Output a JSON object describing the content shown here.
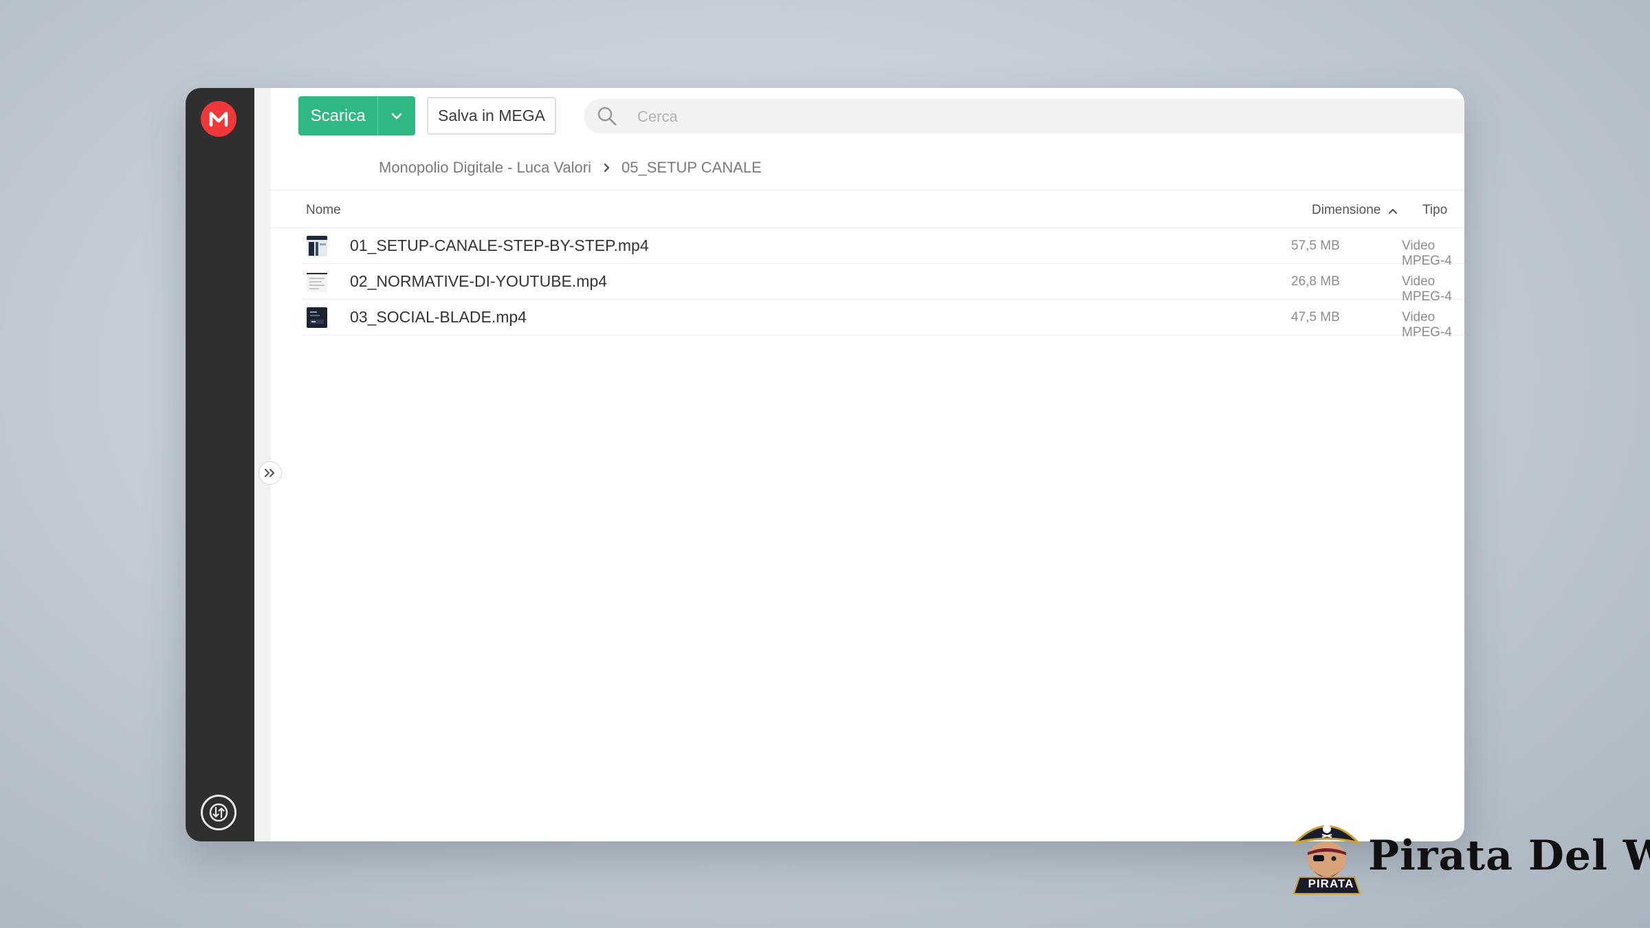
{
  "app": {
    "brand_color": "#f0373a",
    "accent_color": "#2fb784",
    "logo_icon": "mega-logo-icon"
  },
  "toolbar": {
    "download_label": "Scarica",
    "save_label": "Salva in MEGA",
    "search_placeholder": "Cerca"
  },
  "breadcrumb": {
    "items": [
      "Monopolio Digitale - Luca Valori",
      "05_SETUP CANALE"
    ]
  },
  "table": {
    "columns": {
      "name": "Nome",
      "size": "Dimensione",
      "type": "Tipo"
    },
    "sort": {
      "column": "name",
      "direction": "ascending"
    },
    "rows": [
      {
        "name": "01_SETUP-CANALE-STEP-BY-STEP.mp4",
        "size": "57,5 MB",
        "type": "Video MPEG-4"
      },
      {
        "name": "02_NORMATIVE-DI-YOUTUBE.mp4",
        "size": "26,8 MB",
        "type": "Video MPEG-4"
      },
      {
        "name": "03_SOCIAL-BLADE.mp4",
        "size": "47,5 MB",
        "type": "Video MPEG-4"
      }
    ]
  },
  "watermark": {
    "badge": "PIRATA",
    "text": "Pirata Del Web"
  }
}
